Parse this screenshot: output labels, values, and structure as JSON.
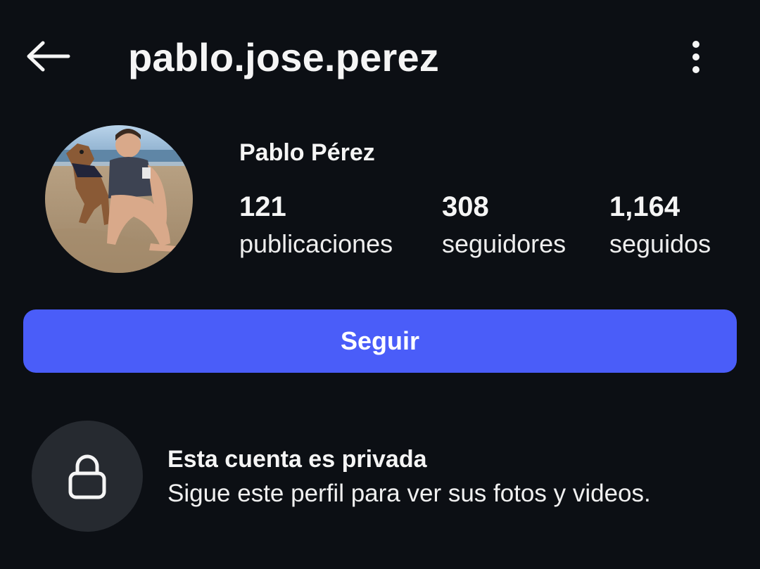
{
  "header": {
    "back_icon": "arrow-left-icon",
    "username": "pablo.jose.perez",
    "more_icon": "vertical-ellipsis-icon"
  },
  "profile": {
    "avatar": "profile-photo (man with dog on beach)",
    "display_name": "Pablo Pérez",
    "stats": {
      "posts": {
        "value": "121",
        "label": "publicaciones"
      },
      "followers": {
        "value": "308",
        "label": "seguidores"
      },
      "following": {
        "value": "1,164",
        "label": "seguidos"
      }
    }
  },
  "follow_button": {
    "label": "Seguir",
    "color": "#4a5df9"
  },
  "private_notice": {
    "icon": "lock-icon",
    "title": "Esta cuenta es privada",
    "subtitle": "Sigue este perfil para ver sus fotos y videos."
  },
  "colors": {
    "background": "#0c0f14",
    "text": "#f5f5f5",
    "accent": "#4a5df9",
    "lock_circle": "#262a30"
  }
}
